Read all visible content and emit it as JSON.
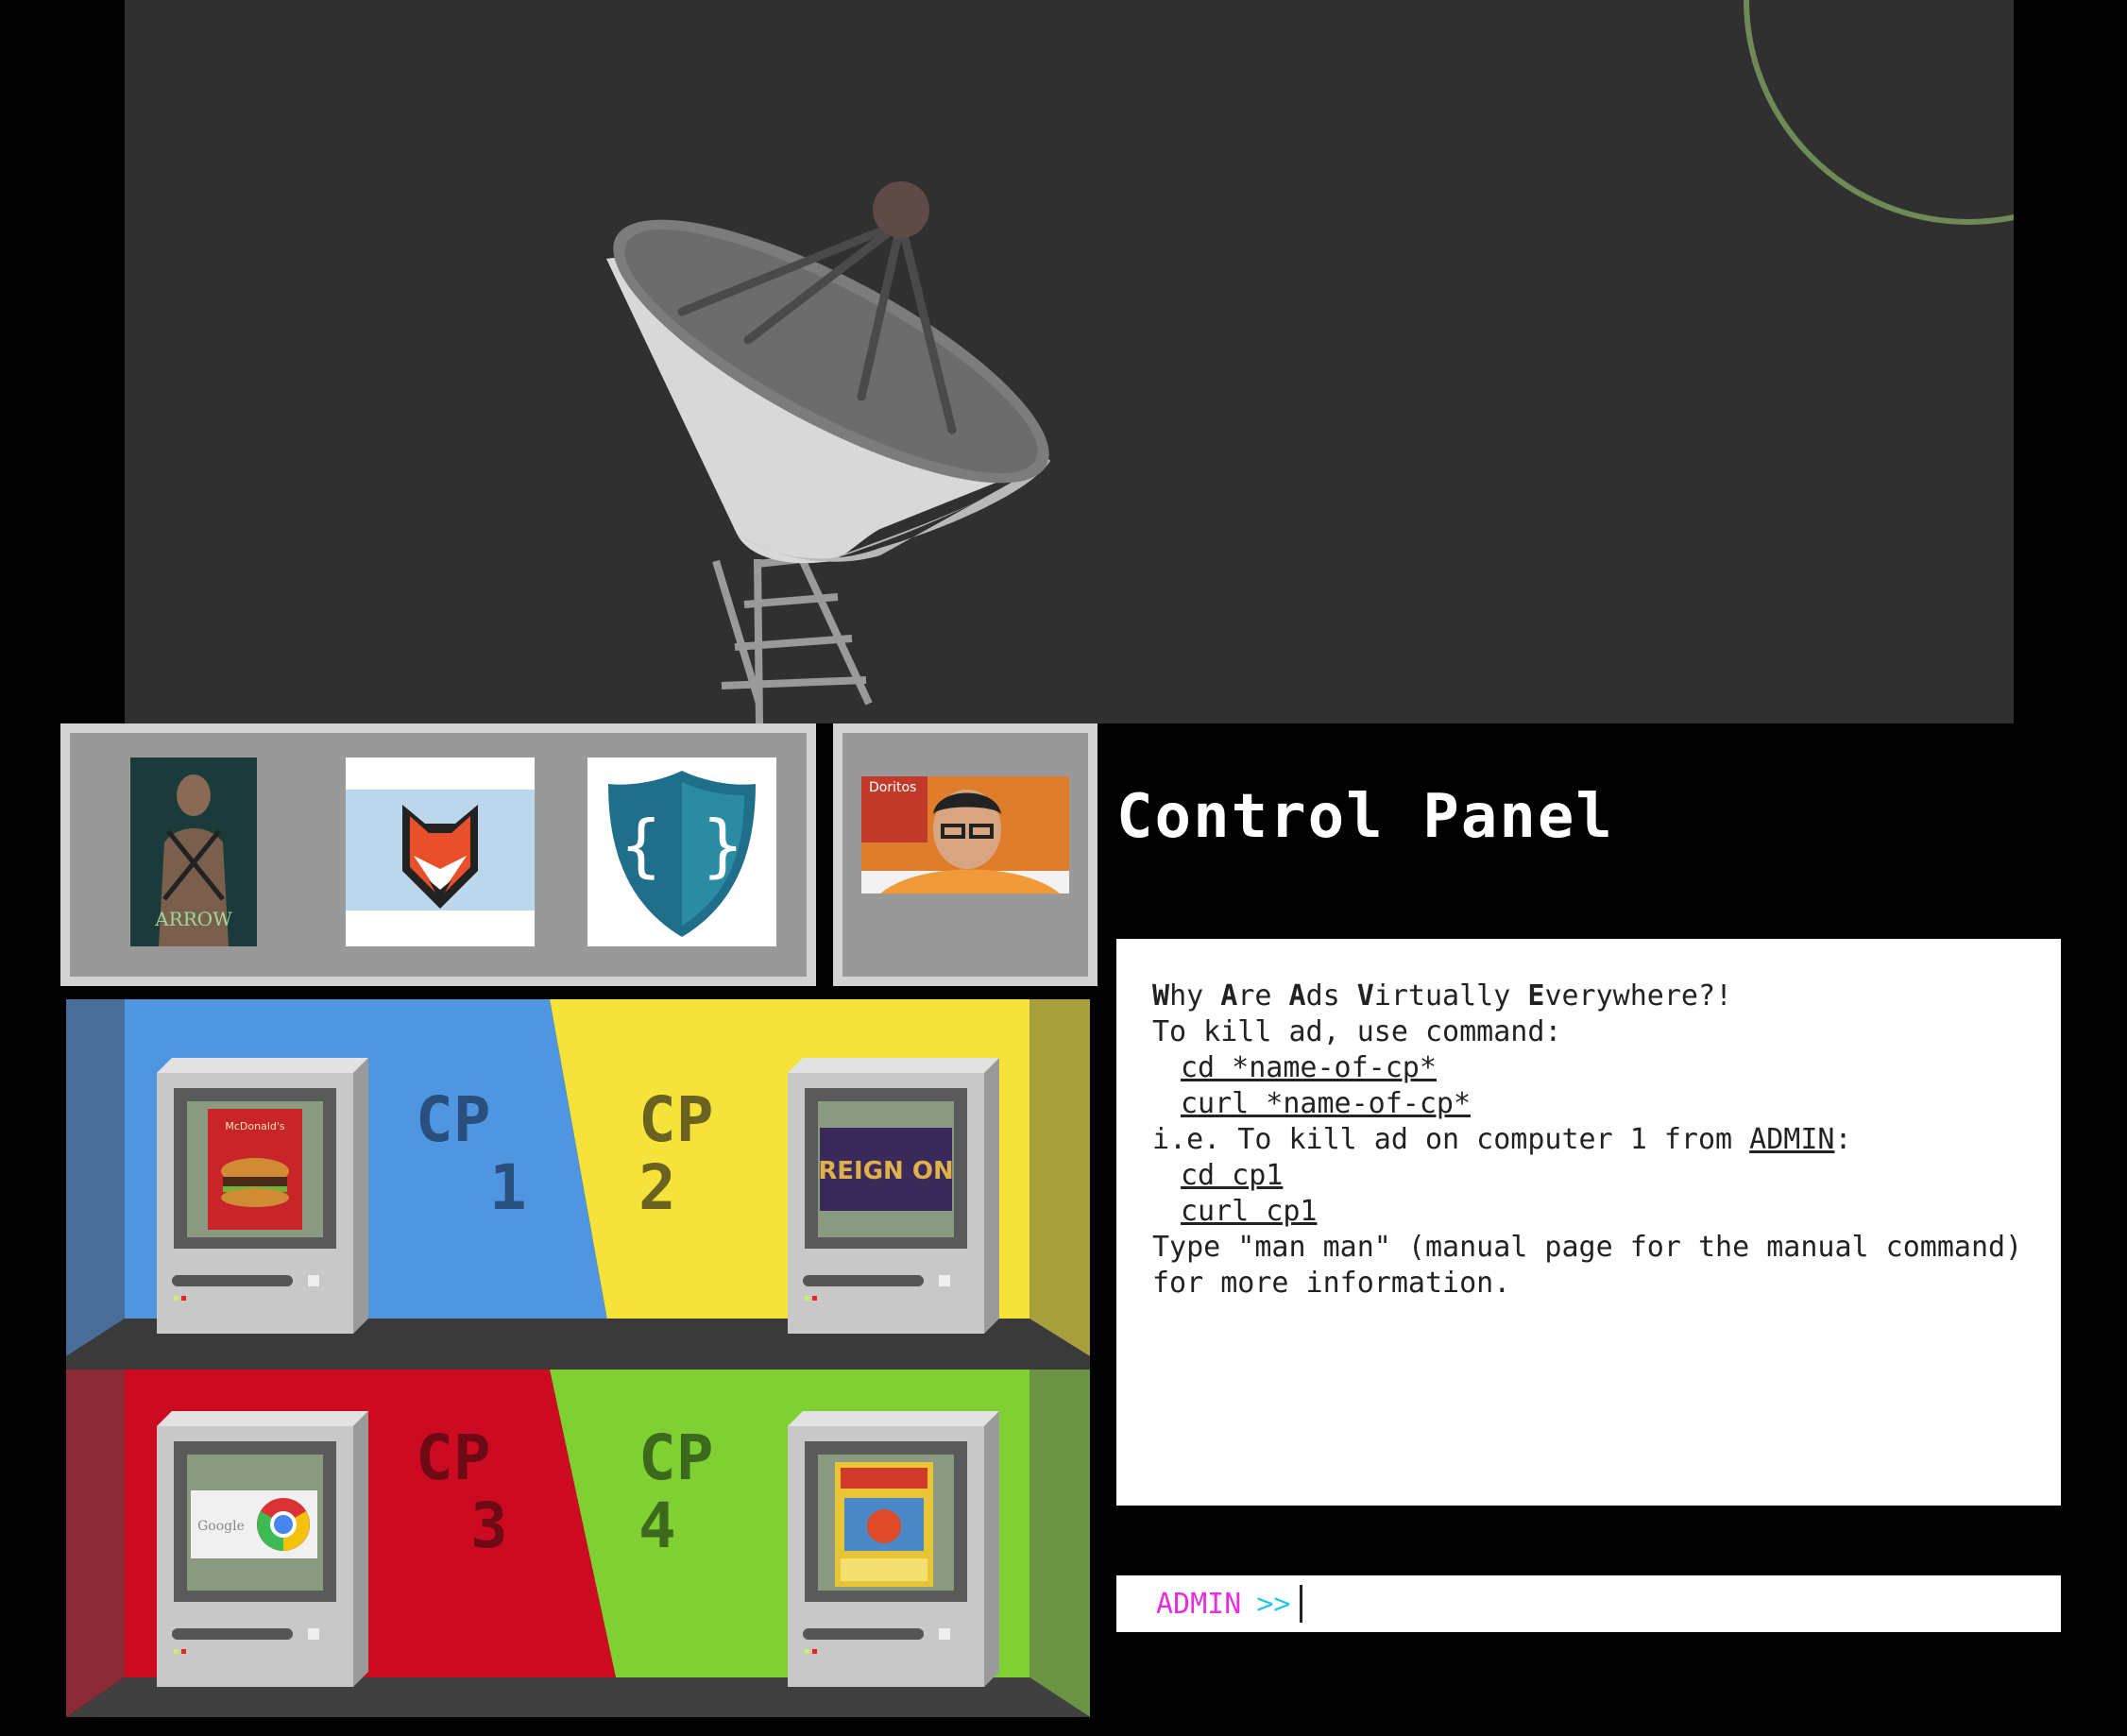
{
  "control_panel": {
    "title": "Control Panel"
  },
  "terminal": {
    "acronym": [
      {
        "initial": "W",
        "rest": "hy "
      },
      {
        "initial": "A",
        "rest": "re "
      },
      {
        "initial": "A",
        "rest": "ds "
      },
      {
        "initial": "V",
        "rest": "irtually "
      },
      {
        "initial": "E",
        "rest": "verywhere?!"
      }
    ],
    "usage_line": "To kill ad, use command:",
    "cmd_cd_template": "cd *name-of-cp*",
    "cmd_curl_template": "curl *name-of-cp*",
    "example_prefix": "i.e. To kill ad on computer 1 from ",
    "example_admin": "ADMIN",
    "example_suffix": ":",
    "cmd_cd_example": "cd cp1",
    "cmd_curl_example": "curl cp1",
    "man_line1": "Type \"man man\" (manual page for the manual command)",
    "man_line2": "for more information."
  },
  "prompt": {
    "user": "ADMIN",
    "arrow": ">>",
    "value": ""
  },
  "rooms": [
    {
      "label": "CP",
      "num": "1",
      "color": "#4f95e0",
      "label_color": "#284f7e"
    },
    {
      "label": "CP",
      "num": "2",
      "color": "#f5e23a",
      "label_color": "#6b6221"
    },
    {
      "label": "CP",
      "num": "3",
      "color": "#cc0b22",
      "label_color": "#6d0a14"
    },
    {
      "label": "CP",
      "num": "4",
      "color": "#80d033",
      "label_color": "#3b6a1c"
    }
  ],
  "ads": {
    "tray": [
      "ARROW",
      "",
      "{ }"
    ],
    "side": "Doritos",
    "cp1": "McDonald's",
    "cp2": "REIGN ON",
    "cp3": "Google",
    "cp4": ""
  },
  "colors": {
    "sky": "#303030",
    "tray": "#999999",
    "moon": "#6f8a57"
  },
  "icons": [
    "satellite-dish-icon",
    "fox-shield-icon",
    "code-shield-icon",
    "computer-icon"
  ]
}
